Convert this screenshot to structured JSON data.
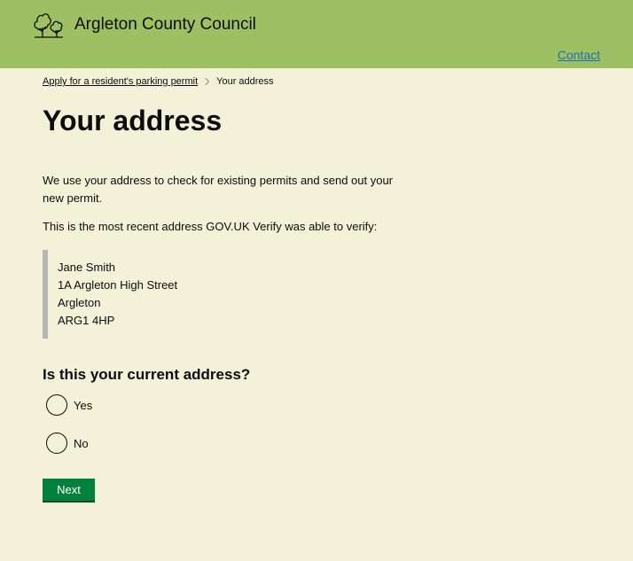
{
  "header": {
    "org_name": "Argleton County Council",
    "logo_icon": "trees-icon",
    "contact_label": "Contact"
  },
  "breadcrumbs": {
    "parent_label": "Apply for a resident's parking permit",
    "current_label": "Your address"
  },
  "page": {
    "title": "Your address",
    "intro": "We use your address to check for existing permits and send out your new permit.",
    "verify_note": "This is the most recent address GOV.UK Verify was able to verify:"
  },
  "address": {
    "lines": [
      "Jane Smith",
      "1A Argleton High Street",
      "Argleton",
      "ARG1 4HP"
    ]
  },
  "question": {
    "label": "Is this your current address?",
    "options": [
      "Yes",
      "No"
    ]
  },
  "actions": {
    "next_label": "Next"
  },
  "colors": {
    "header_bg": "#9fc062",
    "page_bg": "#f3f2d8",
    "link": "#1d70b8",
    "button": "#00813b"
  }
}
